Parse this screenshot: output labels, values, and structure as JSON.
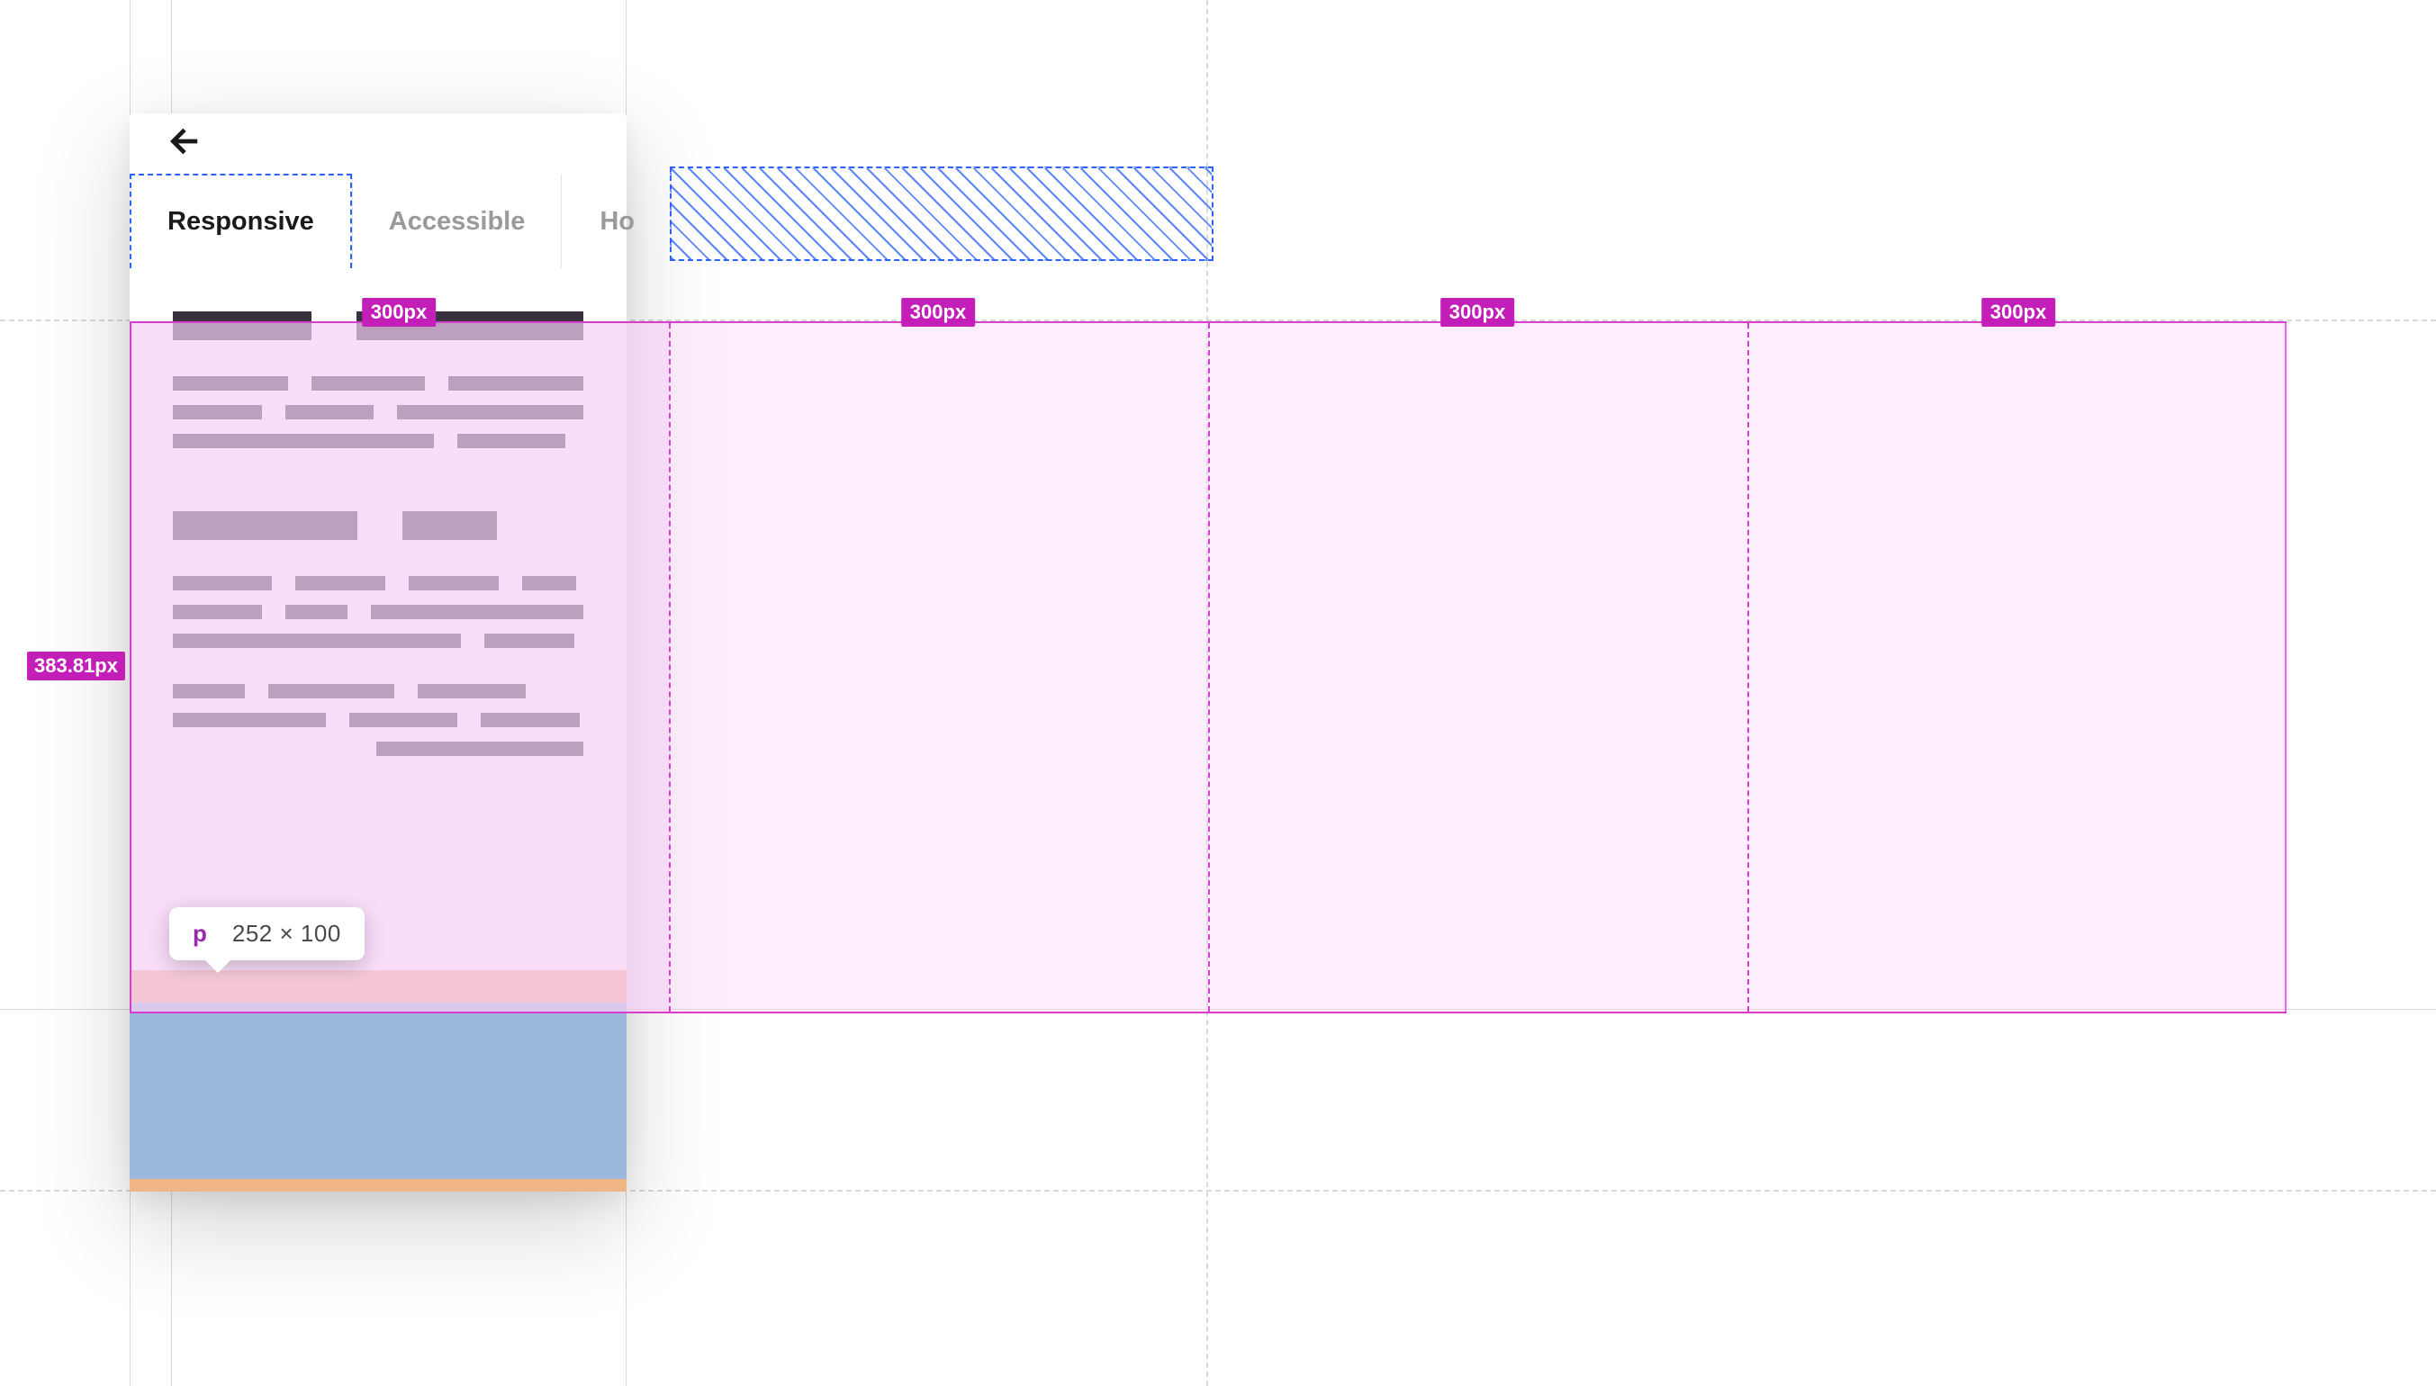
{
  "tabs": {
    "items": [
      {
        "label": "Responsive",
        "active": true
      },
      {
        "label": "Accessible",
        "active": false
      },
      {
        "label": "Horizontal",
        "active": false
      }
    ],
    "visible_partial_last_label": "Horizo"
  },
  "grid_overlay": {
    "height_label": "383.81px",
    "columns": [
      {
        "width_label": "300px"
      },
      {
        "width_label": "300px"
      },
      {
        "width_label": "300px"
      },
      {
        "width_label": "300px"
      }
    ]
  },
  "tooltip": {
    "tag": "p",
    "dimensions": "252 × 100"
  },
  "colors": {
    "grid_accent": "#c31fb8",
    "grid_fill": "#f7cef6",
    "selection_blue": "#2b63ff",
    "placeholder_bar": "#38303c",
    "media_blue": "#9bb9dc",
    "media_orange": "#f0b584"
  }
}
